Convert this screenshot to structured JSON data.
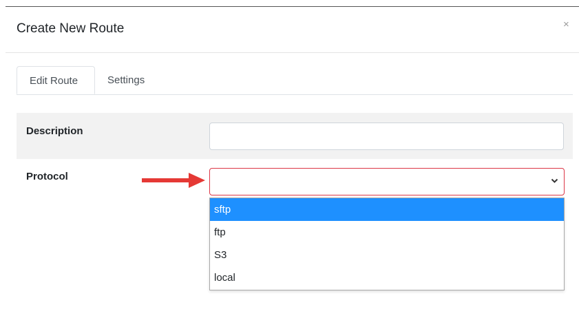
{
  "modal": {
    "title": "Create New Route",
    "close_label": "×"
  },
  "tabs": [
    {
      "label": "Edit Route",
      "active": true
    },
    {
      "label": "Settings",
      "active": false
    }
  ],
  "form": {
    "description": {
      "label": "Description",
      "value": ""
    },
    "protocol": {
      "label": "Protocol",
      "value": "",
      "options": [
        "sftp",
        "ftp",
        "S3",
        "local"
      ],
      "highlighted_option": "sftp"
    }
  },
  "colors": {
    "highlight": "#1e90ff",
    "invalid_border": "#dc3545",
    "arrow": "#e53935",
    "row_background": "#f2f2f2"
  },
  "icons": {
    "close": "close-icon",
    "select_chevron": "chevron-down-icon",
    "pointer": "red-arrow-icon"
  }
}
